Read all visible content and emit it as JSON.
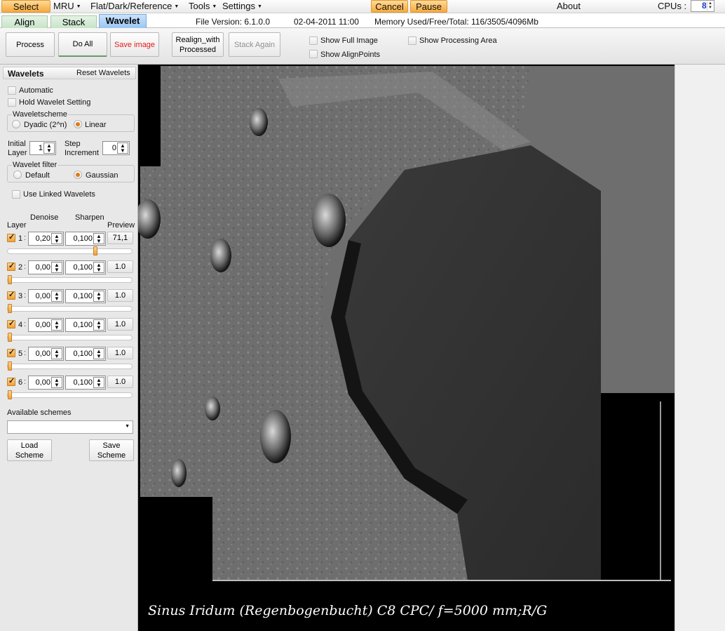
{
  "menu": {
    "select": "Select",
    "mru": "MRU",
    "flat": "Flat/Dark/Reference",
    "tools": "Tools",
    "settings": "Settings",
    "cancel": "Cancel",
    "pause": "Pause",
    "about": "About",
    "cpus_label": "CPUs :",
    "cpus_value": "8"
  },
  "tabs": {
    "align": "Align",
    "stack": "Stack",
    "wavelet": "Wavelet",
    "active": "Wavelet"
  },
  "status": {
    "file_version": "File Version: 6.1.0.0",
    "datetime": "02-04-2011 11:00",
    "memory": "Memory Used/Free/Total: 116/3505/4096Mb"
  },
  "toolbar": {
    "process": "Process",
    "do_all": "Do All",
    "save_image": "Save image",
    "realign": "Realign_with Processed",
    "stack_again": "Stack Again",
    "show_full_image": "Show Full Image",
    "show_align_points": "Show AlignPoints",
    "show_processing_area": "Show Processing Area"
  },
  "panel": {
    "title": "Wavelets",
    "reset": "Reset Wavelets",
    "automatic": "Automatic",
    "hold": "Hold Wavelet Setting",
    "scheme_group": "Waveletscheme",
    "dyadic": "Dyadic (2^n)",
    "linear": "Linear",
    "scheme_selected": "Linear",
    "initial_layer_label1": "Initial",
    "initial_layer_label2": "Layer",
    "initial_layer": "1",
    "step_label1": "Step",
    "step_label2": "Increment",
    "step": "0",
    "filter_group": "Wavelet filter",
    "filter_default": "Default",
    "filter_gaussian": "Gaussian",
    "filter_selected": "Gaussian",
    "use_linked": "Use Linked Wavelets",
    "col_layer": "Layer",
    "col_denoise": "Denoise",
    "col_sharpen": "Sharpen",
    "col_preview": "Preview",
    "layers": [
      {
        "num": "1",
        "checked": true,
        "denoise": "0,20",
        "sharpen": "0,100",
        "preview": "71,1",
        "slider": 0.71
      },
      {
        "num": "2",
        "checked": true,
        "denoise": "0,00",
        "sharpen": "0,100",
        "preview": "1.0",
        "slider": 0.0
      },
      {
        "num": "3",
        "checked": true,
        "denoise": "0,00",
        "sharpen": "0,100",
        "preview": "1.0",
        "slider": 0.0
      },
      {
        "num": "4",
        "checked": true,
        "denoise": "0,00",
        "sharpen": "0,100",
        "preview": "1.0",
        "slider": 0.0
      },
      {
        "num": "5",
        "checked": true,
        "denoise": "0,00",
        "sharpen": "0,100",
        "preview": "1.0",
        "slider": 0.0
      },
      {
        "num": "6",
        "checked": true,
        "denoise": "0,00",
        "sharpen": "0,100",
        "preview": "1.0",
        "slider": 0.0
      }
    ],
    "available_schemes": "Available schemes",
    "scheme_value": "",
    "load_scheme": "Load Scheme",
    "save_scheme": "Save Scheme"
  },
  "image": {
    "caption": "Sinus Iridum (Regenbogenbucht) C8 CPC/ f=5000 mm;R/G"
  },
  "colors": {
    "accent_orange": "#f6a93d",
    "active_tab": "#98c5f0",
    "inactive_tab": "#c5e3c5",
    "save_text": "#e21c1c"
  }
}
